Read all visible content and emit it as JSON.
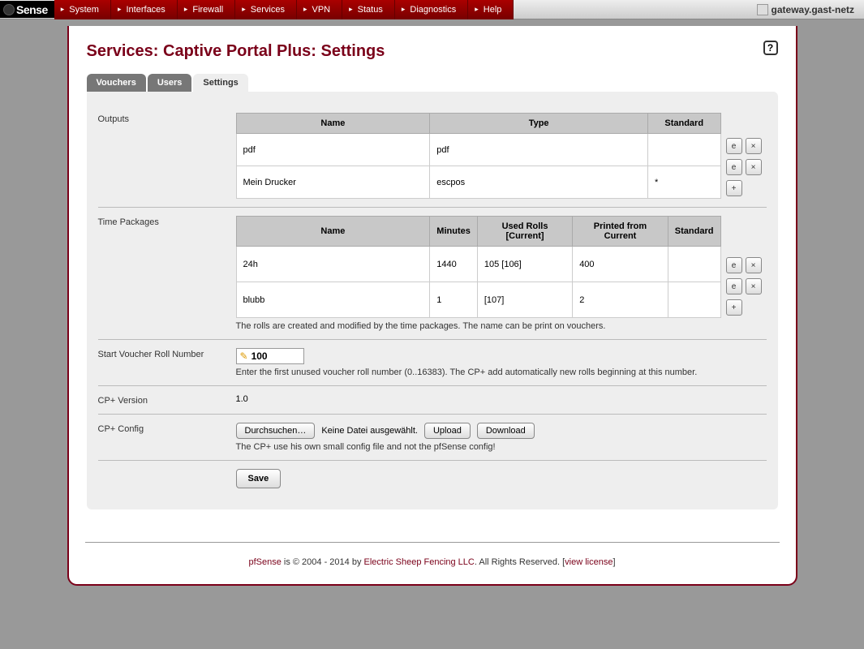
{
  "logo": "Sense",
  "menu": [
    "System",
    "Interfaces",
    "Firewall",
    "Services",
    "VPN",
    "Status",
    "Diagnostics",
    "Help"
  ],
  "hostname": "gateway.gast-netz",
  "page_title": "Services: Captive Portal Plus: Settings",
  "tabs": {
    "vouchers": "Vouchers",
    "users": "Users",
    "settings": "Settings"
  },
  "outputs": {
    "label": "Outputs",
    "headers": {
      "name": "Name",
      "type": "Type",
      "standard": "Standard"
    },
    "rows": [
      {
        "name": "pdf",
        "type": "pdf",
        "standard": ""
      },
      {
        "name": "Mein Drucker",
        "type": "escpos",
        "standard": "*"
      }
    ]
  },
  "time_packages": {
    "label": "Time Packages",
    "headers": {
      "name": "Name",
      "minutes": "Minutes",
      "used": "Used Rolls [Current]",
      "printed": "Printed from Current",
      "standard": "Standard"
    },
    "rows": [
      {
        "name": "24h",
        "minutes": "1440",
        "used": "105  [106]",
        "printed": "400",
        "standard": ""
      },
      {
        "name": "blubb",
        "minutes": "1",
        "used": "[107]",
        "printed": "2",
        "standard": ""
      }
    ],
    "note": "The rolls are created and modified by the time packages. The name can be print on vouchers."
  },
  "start_roll": {
    "label": "Start Voucher Roll Number",
    "value": "100",
    "help": "Enter the first unused voucher roll number (0..16383). The CP+ add automatically new rolls beginning at this number."
  },
  "cp_version": {
    "label": "CP+ Version",
    "value": "1.0"
  },
  "cp_config": {
    "label": "CP+ Config",
    "browse": "Durchsuchen…",
    "no_file": "Keine Datei ausgewählt.",
    "upload": "Upload",
    "download": "Download",
    "help": "The CP+ use his own small config file and not the pfSense config!"
  },
  "save": "Save",
  "footer": {
    "brand": "pfSense",
    "mid": " is © 2004 - 2014 by ",
    "company": "Electric Sheep Fencing LLC",
    "tail": ". All Rights Reserved. [",
    "license": "view license",
    "close": "]"
  }
}
